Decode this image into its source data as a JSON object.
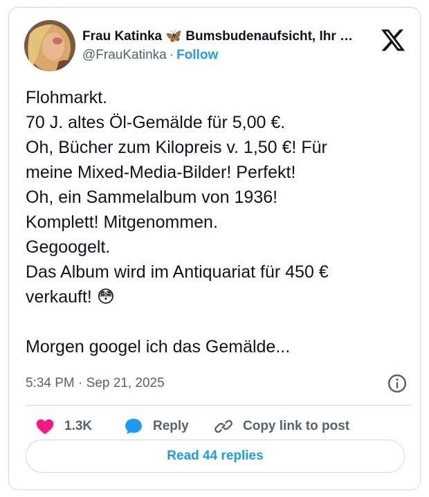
{
  "author": {
    "display_name": "Frau Katinka 🦋 Bumsbudenaufsicht, Ihr …",
    "handle": "@FrauKatinka",
    "separator": "·",
    "follow_label": "Follow"
  },
  "tweet": {
    "lines": [
      "Flohmarkt.",
      "70 J. altes Öl-Gemälde für 5,00  €.",
      "Oh, Bücher zum Kilopreis v. 1,50 €! Für",
      "meine Mixed-Media-Bilder! Perfekt!",
      "Oh, ein Sammelalbum von 1936!",
      "Komplett! Mitgenommen.",
      "Gegoogelt.",
      "Das Album wird im Antiquariat für 450 €",
      "verkauft! 😳",
      "",
      "Morgen googel ich das Gemälde..."
    ],
    "timestamp": "5:34 PM · Sep 21, 2025"
  },
  "actions": {
    "like_count": "1.3K",
    "reply_label": "Reply",
    "copy_link_label": "Copy link to post"
  },
  "replies_button_label": "Read 44 replies",
  "icons": {
    "logo": "x-logo-icon",
    "info": "info-icon",
    "like": "heart-icon",
    "reply": "speech-bubble-icon",
    "copy": "link-icon"
  },
  "colors": {
    "accent": "#1d9bf0",
    "heart": "#f91880",
    "secondary_text": "#536471",
    "border": "#cfd9de"
  }
}
